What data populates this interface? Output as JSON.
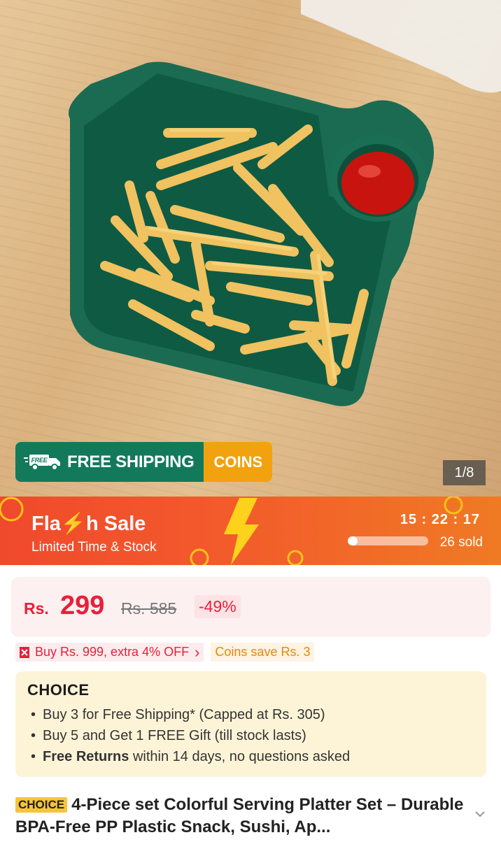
{
  "hero": {
    "shipping_free_tag": "FREE",
    "shipping_label": "FREE SHIPPING",
    "coins_label": "COINS",
    "image_counter": "1/8"
  },
  "flash_sale": {
    "title": "Fla⚡h Sale",
    "subtitle": "Limited Time & Stock",
    "timer": "15 : 22 : 17",
    "sold": "26 sold",
    "sold_progress": 0.12
  },
  "price": {
    "currency": "Rs.",
    "current": "299",
    "original": "Rs. 585",
    "discount": "-49%"
  },
  "promos": {
    "coupon": "Buy Rs. 999, extra 4% OFF",
    "coupon_arrow": "›",
    "coins_save": "Coins save Rs. 3"
  },
  "choice": {
    "logo": "CHOICE",
    "items": [
      {
        "bold": "",
        "text": "Buy 3 for  Free Shipping* (Capped at Rs. 305)"
      },
      {
        "bold": "",
        "text": "Buy 5 and Get 1 FREE Gift (till stock lasts)"
      },
      {
        "bold": "Free Returns",
        "text": " within 14 days, no questions asked"
      }
    ]
  },
  "product": {
    "badge": "CHOICE",
    "title": "4-Piece set Colorful Serving Platter Set – Durable BPA-Free PP Plastic Snack, Sushi, Ap..."
  },
  "colors": {
    "flash_red": "#f04a2c",
    "price_red": "#e8203a",
    "shipping_green": "#127a5a",
    "coins_orange": "#f2a20f"
  }
}
